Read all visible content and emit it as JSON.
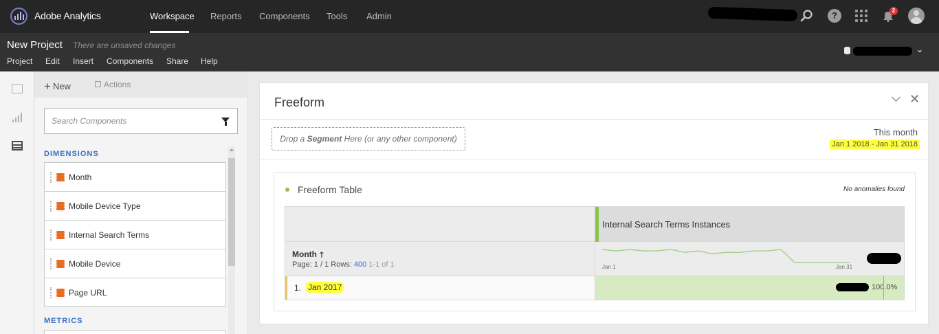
{
  "app": {
    "name": "Adobe Analytics",
    "nav": [
      "Workspace",
      "Reports",
      "Components",
      "Tools",
      "Admin"
    ],
    "active_nav": "Workspace",
    "notification_count": "2",
    "help_glyph": "?"
  },
  "project": {
    "title": "New Project",
    "status": "There are unsaved changes",
    "menu": [
      "Project",
      "Edit",
      "Insert",
      "Components",
      "Share",
      "Help"
    ],
    "report_suite_chevron": "⌄"
  },
  "components": {
    "new_label": "New",
    "new_glyph": "+",
    "actions_label": "Actions",
    "search_placeholder": "Search Components",
    "dimensions_heading": "DIMENSIONS",
    "dimensions": [
      "Month",
      "Mobile Device Type",
      "Internal Search Terms",
      "Mobile Device",
      "Page URL"
    ],
    "metrics_heading": "METRICS"
  },
  "panel": {
    "title": "Freeform",
    "close_glyph": "✕",
    "drop_zone": {
      "prefix": "Drop a ",
      "emphasis": "Segment",
      "suffix": " Here (or any other component)"
    },
    "date_label": "This month",
    "date_range": "Jan 1 2018 - Jan 31 2018"
  },
  "table": {
    "title": "Freeform Table",
    "anomalies": "No anomalies found",
    "metric_header": "Internal Search Terms Instances",
    "dimension_header": "Month",
    "sort_glyph": "🡑",
    "pager_prefix": "Page: 1 / 1  Rows: ",
    "rows_value": "400",
    "range": "1-1 of 1",
    "sparkline_start": "Jan 1",
    "sparkline_end": "Jan 31",
    "sparkline_values": [
      12,
      11,
      12,
      11,
      11,
      12,
      10,
      11,
      9,
      10,
      10,
      11,
      11,
      12,
      3,
      3,
      3,
      3,
      3
    ],
    "rows": [
      {
        "index": "1.",
        "value": "Jan 2017",
        "percent": "100.0%"
      }
    ]
  },
  "colors": {
    "accent_green": "#8bc34a",
    "highlight_yellow": "#ffff3c",
    "link_blue": "#326ec8",
    "dimension_orange": "#e86c24"
  },
  "icons": [
    "logo-icon",
    "search-icon",
    "help-icon",
    "apps-icon",
    "bell-icon",
    "avatar",
    "panel-icon",
    "visualization-icon",
    "components-icon",
    "filter-icon",
    "database-icon",
    "chevron-down-icon",
    "close-icon",
    "drag-handle-icon",
    "dimension-icon"
  ]
}
